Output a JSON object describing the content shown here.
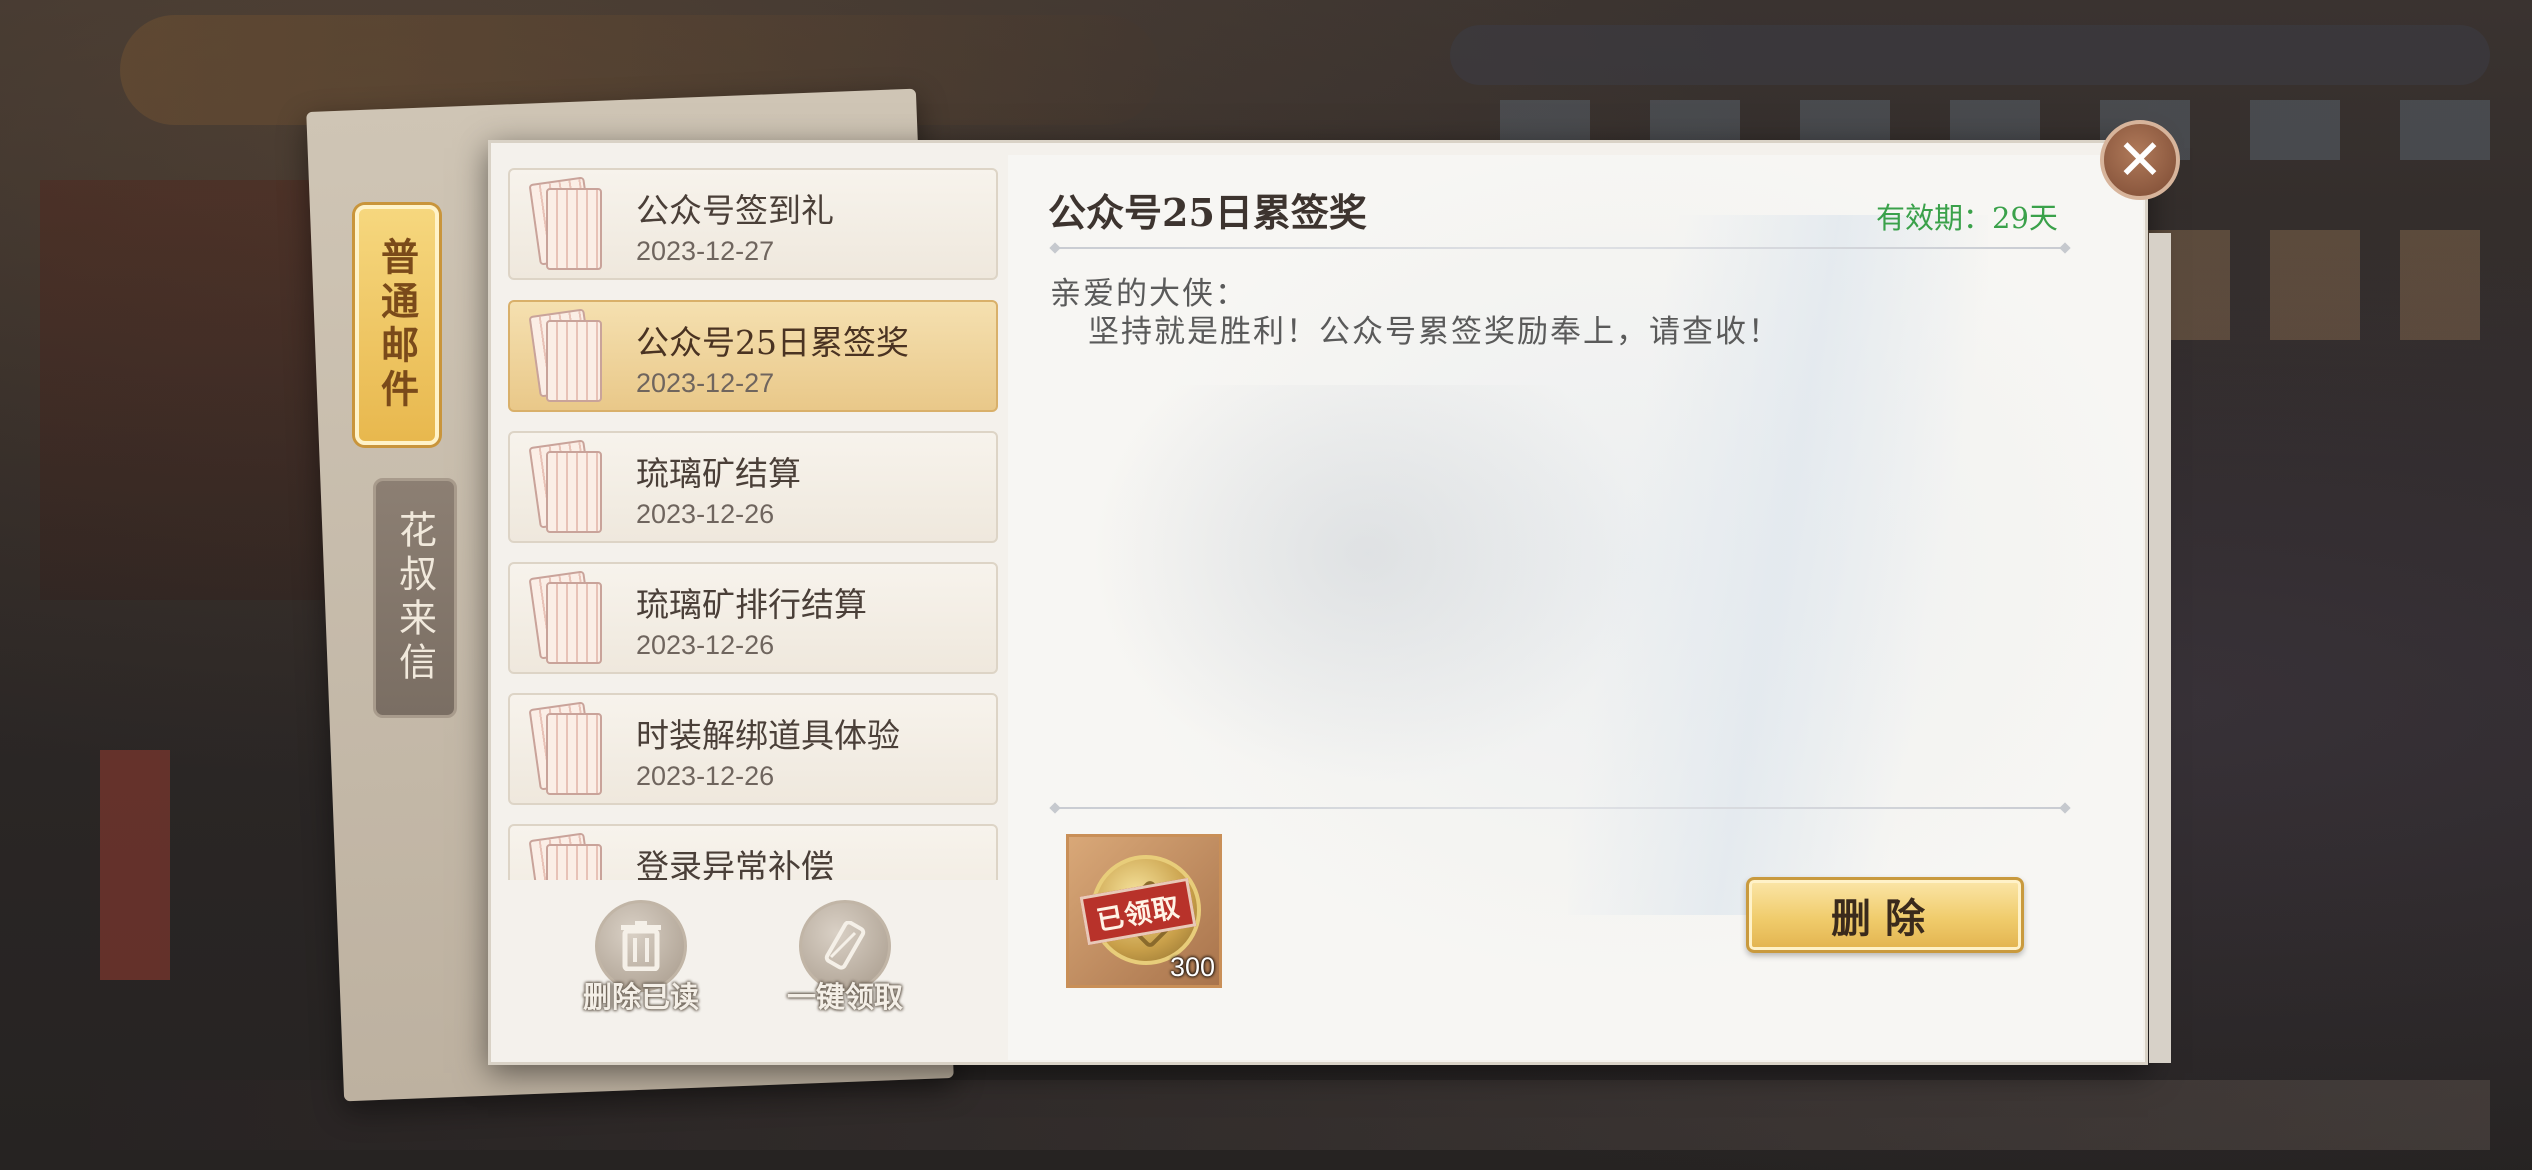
{
  "tabs": {
    "normal_mail": "普通邮件",
    "uncle_letters": "花叔来信"
  },
  "mail_list": [
    {
      "title": "公众号签到礼",
      "date": "2023-12-27",
      "selected": false
    },
    {
      "title": "公众号25日累签奖",
      "date": "2023-12-27",
      "selected": true
    },
    {
      "title": "琉璃矿结算",
      "date": "2023-12-26",
      "selected": false
    },
    {
      "title": "琉璃矿排行结算",
      "date": "2023-12-26",
      "selected": false
    },
    {
      "title": "时装解绑道具体验",
      "date": "2023-12-26",
      "selected": false
    },
    {
      "title": "登录异常补偿",
      "date": "",
      "selected": false
    }
  ],
  "list_actions": {
    "delete_read": "删除已读",
    "collect_all": "一键领取"
  },
  "detail": {
    "subject": "公众号25日累签奖",
    "expiry": "有效期：29天",
    "greeting": "亲爱的大侠：",
    "body": "坚持就是胜利！公众号累签奖励奉上，请查收！"
  },
  "reward": {
    "status": "已领取",
    "count": "300",
    "icon": "gold-coin-icon"
  },
  "buttons": {
    "delete": "删除",
    "close_icon": "close-icon"
  },
  "colors": {
    "expiry_green": "#3aa14a",
    "selected_item": "#e9c889",
    "claimed_stamp": "#b8322a"
  }
}
